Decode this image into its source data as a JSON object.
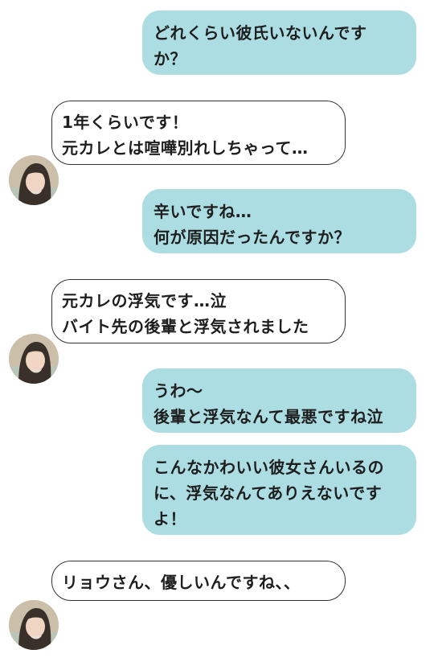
{
  "messages": [
    {
      "side": "sent",
      "text": "どれくらい彼氏いないんです\nか？"
    },
    {
      "side": "received",
      "text": "1年くらいです！\n元カレとは喧嘩別れしちゃって…"
    },
    {
      "side": "sent",
      "text": "辛いですね…\n何が原因だったんですか？"
    },
    {
      "side": "received",
      "text": "元カレの浮気です…泣\nバイト先の後輩と浮気されました"
    },
    {
      "side": "sent",
      "text": "うわ〜\n後輩と浮気なんて最悪ですね泣"
    },
    {
      "side": "sent",
      "text": "こんなかわいい彼女さんいるの\nに、浮気なんてありえないです\nよ！"
    },
    {
      "side": "received",
      "text": "リョウさん、優しいんですね、、"
    }
  ],
  "colors": {
    "sent_bubble": "#acdde3",
    "received_border": "#333333",
    "text": "#1e1e1e",
    "background": "#ffffff"
  },
  "avatar": {
    "icon": "contact-avatar-photo"
  }
}
